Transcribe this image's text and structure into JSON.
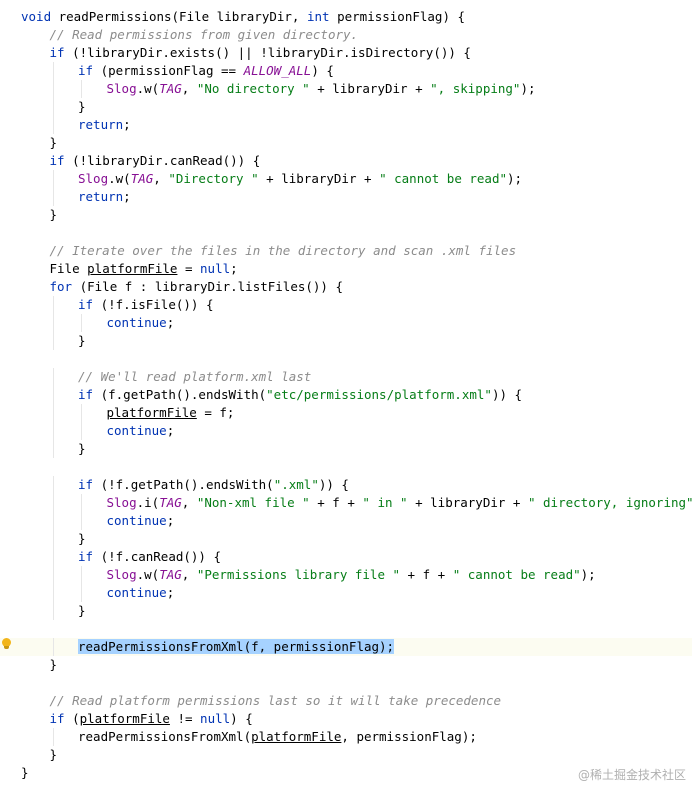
{
  "editor": {
    "current_line": 35,
    "colors": {
      "keyword": "#0033b3",
      "string": "#067d17",
      "comment": "#8c8c8c",
      "constant": "#871094",
      "selection": "#a6d2ff",
      "current_line_bg": "#fcfcf1"
    },
    "lines": [
      {
        "indent": 0,
        "tokens": [
          [
            "kw",
            "void"
          ],
          [
            "p",
            " readPermissions(File libraryDir, "
          ],
          [
            "kw",
            "int"
          ],
          [
            "p",
            " permissionFlag) {"
          ]
        ]
      },
      {
        "indent": 1,
        "tokens": [
          [
            "com",
            "// Read permissions from given directory."
          ]
        ]
      },
      {
        "indent": 1,
        "tokens": [
          [
            "kw",
            "if"
          ],
          [
            "p",
            " (!libraryDir.exists() || !libraryDir.isDirectory()) {"
          ]
        ]
      },
      {
        "indent": 2,
        "tokens": [
          [
            "kw",
            "if"
          ],
          [
            "p",
            " (permissionFlag == "
          ],
          [
            "const",
            "ALLOW_ALL"
          ],
          [
            "p",
            ") {"
          ]
        ]
      },
      {
        "indent": 3,
        "tokens": [
          [
            "field",
            "Slog"
          ],
          [
            "p",
            ".w("
          ],
          [
            "static",
            "TAG"
          ],
          [
            "p",
            ", "
          ],
          [
            "str",
            "\"No directory \""
          ],
          [
            "p",
            " + libraryDir + "
          ],
          [
            "str",
            "\", skipping\""
          ],
          [
            "p",
            ");"
          ]
        ]
      },
      {
        "indent": 2,
        "tokens": [
          [
            "p",
            "}"
          ]
        ]
      },
      {
        "indent": 2,
        "tokens": [
          [
            "kw",
            "return"
          ],
          [
            "p",
            ";"
          ]
        ]
      },
      {
        "indent": 1,
        "tokens": [
          [
            "p",
            "}"
          ]
        ]
      },
      {
        "indent": 1,
        "tokens": [
          [
            "kw",
            "if"
          ],
          [
            "p",
            " (!libraryDir.canRead()) {"
          ]
        ]
      },
      {
        "indent": 2,
        "tokens": [
          [
            "field",
            "Slog"
          ],
          [
            "p",
            ".w("
          ],
          [
            "static",
            "TAG"
          ],
          [
            "p",
            ", "
          ],
          [
            "str",
            "\"Directory \""
          ],
          [
            "p",
            " + libraryDir + "
          ],
          [
            "str",
            "\" cannot be read\""
          ],
          [
            "p",
            ");"
          ]
        ]
      },
      {
        "indent": 2,
        "tokens": [
          [
            "kw",
            "return"
          ],
          [
            "p",
            ";"
          ]
        ]
      },
      {
        "indent": 1,
        "tokens": [
          [
            "p",
            "}"
          ]
        ]
      },
      {
        "indent": 0,
        "tokens": []
      },
      {
        "indent": 1,
        "tokens": [
          [
            "com",
            "// Iterate over the files in the directory and scan .xml files"
          ]
        ]
      },
      {
        "indent": 1,
        "tokens": [
          [
            "p",
            "File "
          ],
          [
            "var",
            "platformFile"
          ],
          [
            "p",
            " = "
          ],
          [
            "kw",
            "null"
          ],
          [
            "p",
            ";"
          ]
        ]
      },
      {
        "indent": 1,
        "tokens": [
          [
            "kw",
            "for"
          ],
          [
            "p",
            " (File f : libraryDir.listFiles()) {"
          ]
        ]
      },
      {
        "indent": 2,
        "tokens": [
          [
            "kw",
            "if"
          ],
          [
            "p",
            " (!f.isFile()) {"
          ]
        ]
      },
      {
        "indent": 3,
        "tokens": [
          [
            "kw",
            "continue"
          ],
          [
            "p",
            ";"
          ]
        ]
      },
      {
        "indent": 2,
        "tokens": [
          [
            "p",
            "}"
          ]
        ]
      },
      {
        "indent": 0,
        "tokens": []
      },
      {
        "indent": 2,
        "tokens": [
          [
            "com",
            "// We'll read platform.xml last"
          ]
        ]
      },
      {
        "indent": 2,
        "tokens": [
          [
            "kw",
            "if"
          ],
          [
            "p",
            " (f.getPath().endsWith("
          ],
          [
            "str",
            "\"etc/permissions/platform.xml\""
          ],
          [
            "p",
            ")) {"
          ]
        ]
      },
      {
        "indent": 3,
        "tokens": [
          [
            "var",
            "platformFile"
          ],
          [
            "p",
            " = f;"
          ]
        ]
      },
      {
        "indent": 3,
        "tokens": [
          [
            "kw",
            "continue"
          ],
          [
            "p",
            ";"
          ]
        ]
      },
      {
        "indent": 2,
        "tokens": [
          [
            "p",
            "}"
          ]
        ]
      },
      {
        "indent": 0,
        "tokens": []
      },
      {
        "indent": 2,
        "tokens": [
          [
            "kw",
            "if"
          ],
          [
            "p",
            " (!f.getPath().endsWith("
          ],
          [
            "str",
            "\".xml\""
          ],
          [
            "p",
            ")) {"
          ]
        ]
      },
      {
        "indent": 3,
        "tokens": [
          [
            "field",
            "Slog"
          ],
          [
            "p",
            ".i("
          ],
          [
            "static",
            "TAG"
          ],
          [
            "p",
            ", "
          ],
          [
            "str",
            "\"Non-xml file \""
          ],
          [
            "p",
            " + f + "
          ],
          [
            "str",
            "\" in \""
          ],
          [
            "p",
            " + libraryDir + "
          ],
          [
            "str",
            "\" directory, ignoring\""
          ],
          [
            "p",
            ");"
          ]
        ]
      },
      {
        "indent": 3,
        "tokens": [
          [
            "kw",
            "continue"
          ],
          [
            "p",
            ";"
          ]
        ]
      },
      {
        "indent": 2,
        "tokens": [
          [
            "p",
            "}"
          ]
        ]
      },
      {
        "indent": 2,
        "tokens": [
          [
            "kw",
            "if"
          ],
          [
            "p",
            " (!f.canRead()) {"
          ]
        ]
      },
      {
        "indent": 3,
        "tokens": [
          [
            "field",
            "Slog"
          ],
          [
            "p",
            ".w("
          ],
          [
            "static",
            "TAG"
          ],
          [
            "p",
            ", "
          ],
          [
            "str",
            "\"Permissions library file \""
          ],
          [
            "p",
            " + f + "
          ],
          [
            "str",
            "\" cannot be read\""
          ],
          [
            "p",
            ");"
          ]
        ]
      },
      {
        "indent": 3,
        "tokens": [
          [
            "kw",
            "continue"
          ],
          [
            "p",
            ";"
          ]
        ]
      },
      {
        "indent": 2,
        "tokens": [
          [
            "p",
            "}"
          ]
        ]
      },
      {
        "indent": 0,
        "tokens": []
      },
      {
        "indent": 2,
        "tokens": [
          [
            "sel",
            "readPermissionsFromXml(f, permissionFlag);"
          ]
        ]
      },
      {
        "indent": 1,
        "tokens": [
          [
            "p",
            "}"
          ]
        ]
      },
      {
        "indent": 0,
        "tokens": []
      },
      {
        "indent": 1,
        "tokens": [
          [
            "com",
            "// Read platform permissions last so it will take precedence"
          ]
        ]
      },
      {
        "indent": 1,
        "tokens": [
          [
            "kw",
            "if"
          ],
          [
            "p",
            " ("
          ],
          [
            "var",
            "platformFile"
          ],
          [
            "p",
            " != "
          ],
          [
            "kw",
            "null"
          ],
          [
            "p",
            ") {"
          ]
        ]
      },
      {
        "indent": 2,
        "tokens": [
          [
            "p",
            "readPermissionsFromXml("
          ],
          [
            "var",
            "platformFile"
          ],
          [
            "p",
            ", permissionFlag);"
          ]
        ]
      },
      {
        "indent": 1,
        "tokens": [
          [
            "p",
            "}"
          ]
        ]
      },
      {
        "indent": 0,
        "tokens": [
          [
            "p",
            "}"
          ]
        ]
      }
    ],
    "gutter_icon": "intention-bulb-icon"
  },
  "watermark": "@稀土掘金技术社区"
}
